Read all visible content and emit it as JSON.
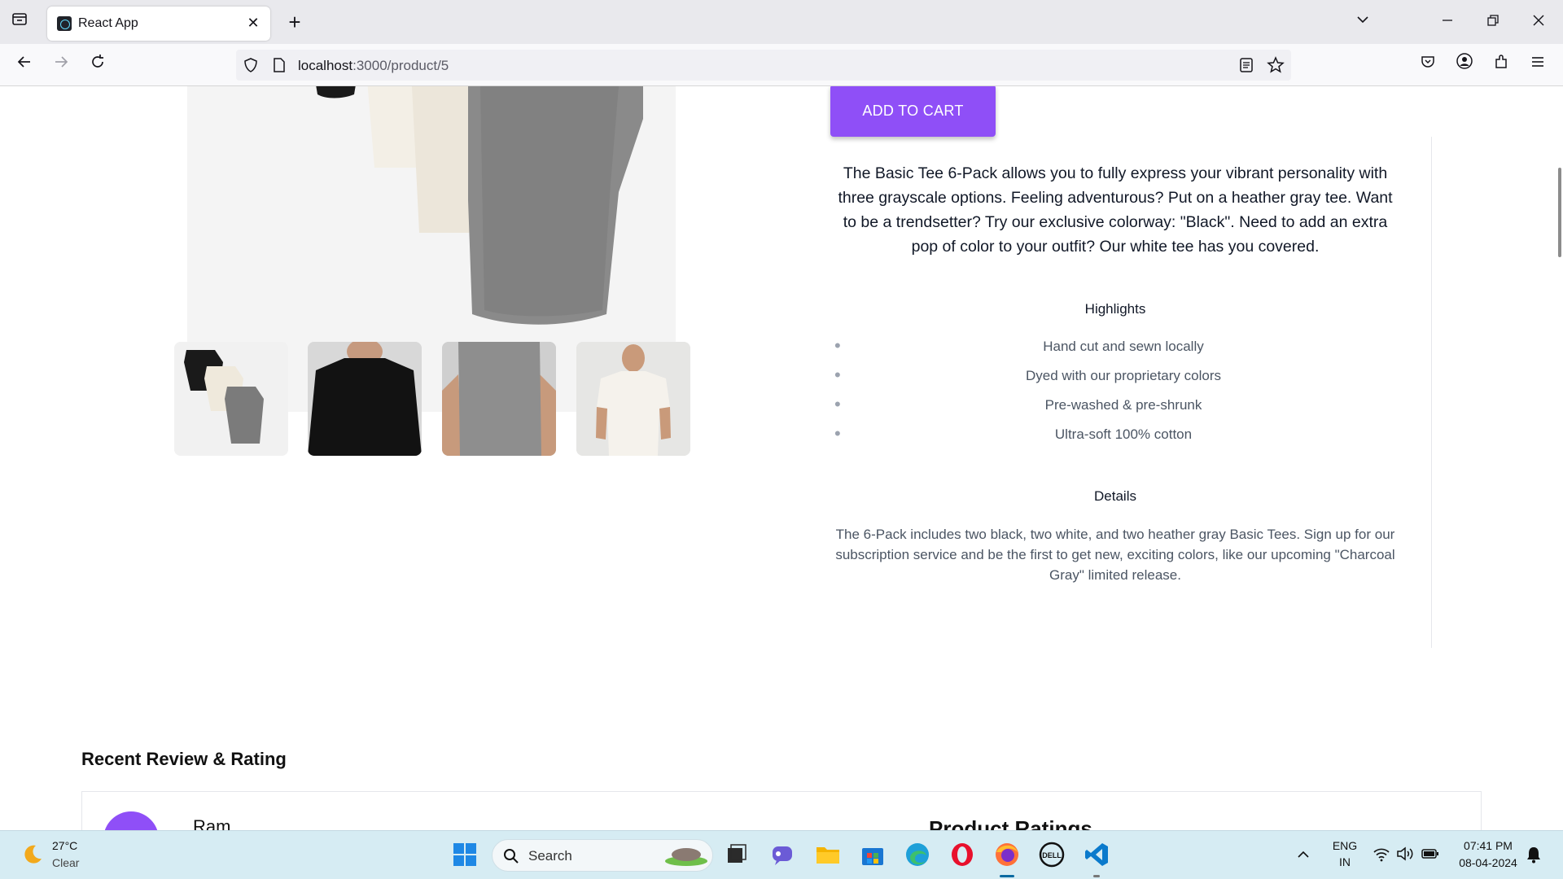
{
  "browser": {
    "tab_title": "React App",
    "tab_close": "✕",
    "new_tab": "+",
    "url_host": "localhost",
    "url_path": ":3000/product/5"
  },
  "product": {
    "add_to_cart": "ADD TO CART",
    "description": "The Basic Tee 6-Pack allows you to fully express your vibrant personality with three grayscale options. Feeling adventurous? Put on a heather gray tee. Want to be a trendsetter? Try our exclusive colorway: \"Black\". Need to add an extra pop of color to your outfit? Our white tee has you covered.",
    "highlights_title": "Highlights",
    "highlights": [
      "Hand cut and sewn locally",
      "Dyed with our proprietary colors",
      "Pre-washed & pre-shrunk",
      "Ultra-soft 100% cotton"
    ],
    "details_title": "Details",
    "details": "The 6-Pack includes two black, two white, and two heather gray Basic Tees. Sign up for our subscription service and be the first to get new, exciting colors, like our upcoming \"Charcoal Gray\" limited release."
  },
  "reviews": {
    "title": "Recent Review & Rating",
    "reviewer_name": "Ram",
    "ratings_title": "Product Ratings"
  },
  "taskbar": {
    "weather_temp": "27°C",
    "weather_desc": "Clear",
    "search_label": "Search",
    "lang_top": "ENG",
    "lang_bottom": "IN",
    "time": "07:41 PM",
    "date": "08-04-2024"
  },
  "colors": {
    "accent": "#8f4ff7"
  }
}
